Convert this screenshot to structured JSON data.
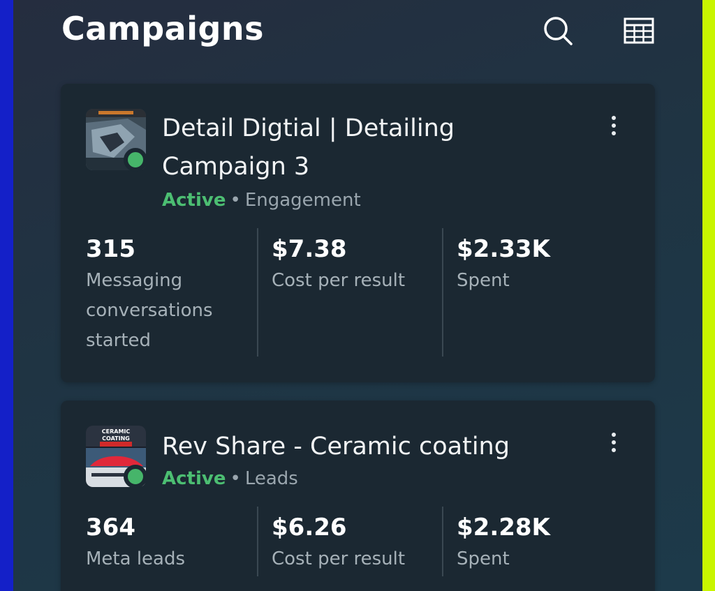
{
  "header": {
    "title": "Campaigns",
    "search_icon": "search-icon",
    "table_icon": "table-icon"
  },
  "colors": {
    "accent_active": "#4cbe72",
    "card_bg": "#1b2832",
    "left_edge": "#1420c8",
    "right_edge": "#c8f500"
  },
  "campaigns": [
    {
      "title": "Detail Digtial | Detailing Campaign 3",
      "status": "Active",
      "objective": "Engagement",
      "metrics": [
        {
          "value": "315",
          "label": "Messaging conversations started"
        },
        {
          "value": "$7.38",
          "label": "Cost per result"
        },
        {
          "value": "$2.33K",
          "label": "Spent"
        }
      ]
    },
    {
      "title": "Rev Share - Ceramic coating",
      "status": "Active",
      "objective": "Leads",
      "thumb_text": "CERAMIC COATING",
      "metrics": [
        {
          "value": "364",
          "label": "Meta leads"
        },
        {
          "value": "$6.26",
          "label": "Cost per result"
        },
        {
          "value": "$2.28K",
          "label": "Spent"
        }
      ]
    }
  ]
}
